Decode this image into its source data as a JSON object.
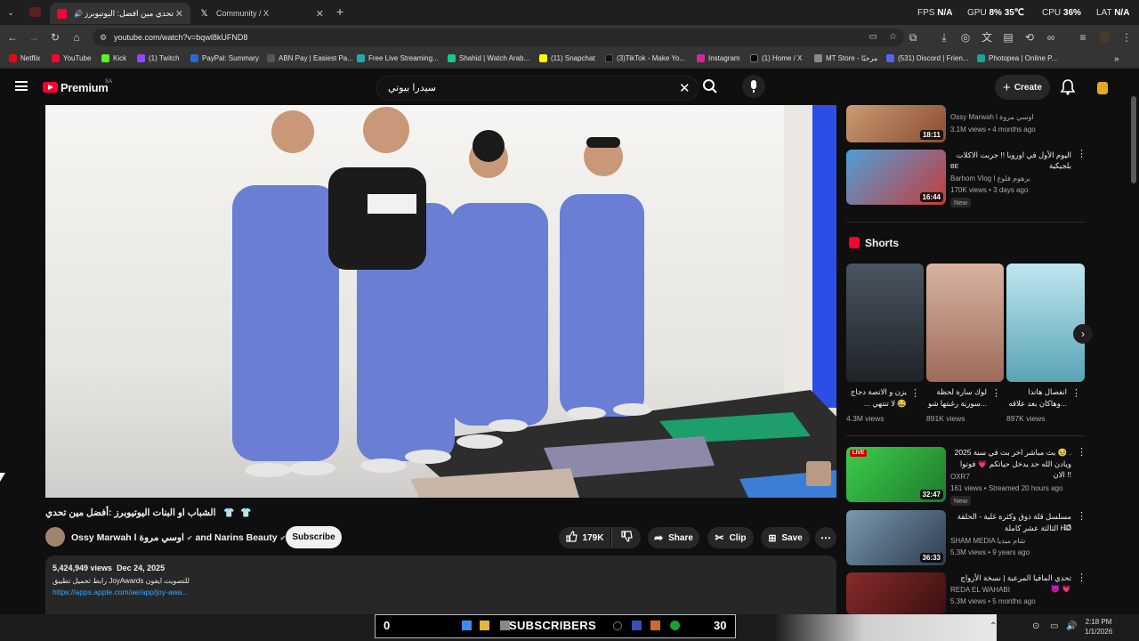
{
  "browser": {
    "tabs": [
      {
        "title": "تحدي مين افضل: اليوتيوبرز ال"
      },
      {
        "title": "Community / X"
      }
    ],
    "stats": {
      "fps_label": "FPS",
      "fps": "N/A",
      "gpu_label": "GPU",
      "gpu": "8%",
      "gpu_temp": "35℃",
      "cpu_label": "CPU",
      "cpu": "36%",
      "lat_label": "LAT",
      "lat": "N/A"
    },
    "url": "youtube.com/watch?v=bqwl8kUFND8",
    "bookmarks": [
      "Netflix",
      "YouTube",
      "Kick",
      "(1) Twitch",
      "PayPal: Summary",
      "ABN Pay | Easiest Pa...",
      "Free Live Streaming...",
      "Shahid | Watch Arab...",
      "(11) Snapchat",
      "(3)TikTok - Make Yo...",
      "Instagram",
      "(1) Home / X",
      "MT Store - مرحبًا",
      "(531) Discord | Frien...",
      "Photopea | Online P..."
    ]
  },
  "youtube": {
    "logo": "Premium",
    "region": "SA",
    "search_query": "سيدرا بيوتي",
    "create_label": "Create"
  },
  "video": {
    "title": "الشباب او البنات اليوتيوبرز :أفضل مين تحدي",
    "channel": "Ossy Marwah l اوسي مروة",
    "collab": "and Narins Beauty",
    "subscribe": "Subscribe",
    "likes": "179K",
    "share": "Share",
    "clip": "Clip",
    "save": "Save",
    "views": "5,424,949 views",
    "date": "Dec 24, 2025",
    "desc_line": "رابط تحميل تطبيق JoyAwards للتصويت ايفون",
    "desc_link": "https://apps.apple.com/ae/app/joy-awa..."
  },
  "sidebar": {
    "top": [
      {
        "channel": "Ossy Marwah l اوسي مروة",
        "meta": "3.1M views • 4 months ago",
        "duration": "18:11"
      },
      {
        "title": "اليوم الأول في اوروبا !! جربت الاكلات بلجيكية",
        "title2": "BE",
        "channel": "Barhom Vlog l برهوم فلوغ",
        "meta": "170K views • 3 days ago",
        "duration": "16:44",
        "badge": "New"
      }
    ],
    "shorts_label": "Shorts",
    "shorts": [
      {
        "title": "يزن و الاتصة دجاج",
        "title2": "... لا تنتهي 😂",
        "views": "4.3M views"
      },
      {
        "title": "لوك سارة لحظة",
        "title2": "سورية رغبتها شو...",
        "views": "891K views"
      },
      {
        "title": "انفصال هاندا",
        "title2": "وهاكان بعد علاقه...",
        "views": "897K views"
      }
    ],
    "bottom": [
      {
        "title": "بث مباشر اخر بث في سنة 2025 🥹 .",
        "title2": "ويادن الله حد يدخل حياتكم 💗 فوتوا الان !!",
        "channel": "OXR7",
        "meta": "161 views • Streamed 20 hours ago",
        "duration": "32:47",
        "badge": "New",
        "live": "LIVE"
      },
      {
        "title": "مسلسل قلة ذوق وكثرة غلبة - الحلقة 13",
        "title2": "الثالثة عشر كاملة HD",
        "channel": "SHAM MEDIA شام ميديا",
        "meta": "5.3M views • 9 years ago",
        "duration": "36:33"
      },
      {
        "title": "تحدي المافيا المرعبة | نسخة الأزواج 😈 💗",
        "channel": "REDA EL WAHABI",
        "meta": "5.3M views • 5 months ago"
      }
    ]
  },
  "overlay": {
    "left_num": "0",
    "label": "SUBSCRIBERS",
    "right_num": "30"
  },
  "taskbar": {
    "time": "2:18 PM",
    "date": "1/1/2026"
  },
  "colors": {
    "accent_red": "#ff0033",
    "background": "#0f0f0f",
    "link": "#3ea6ff"
  }
}
